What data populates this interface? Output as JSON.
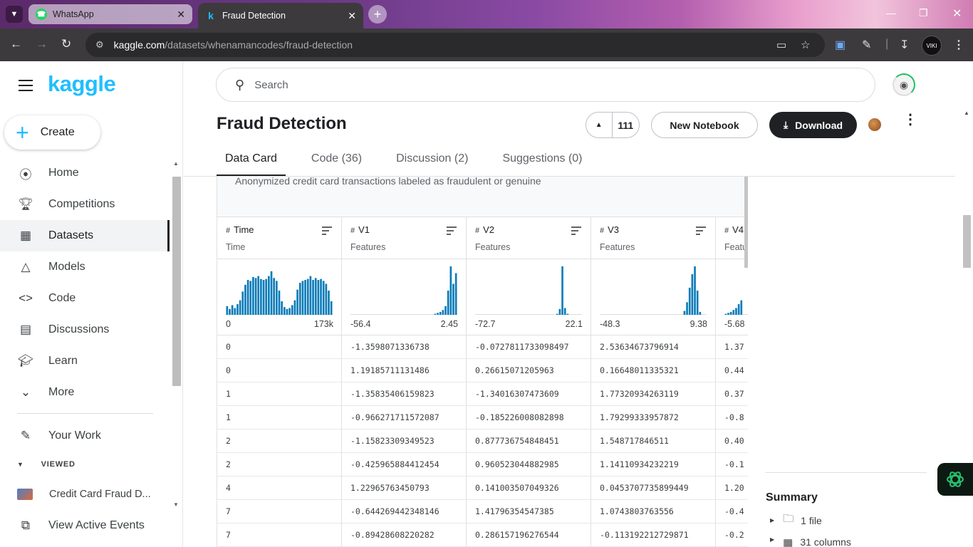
{
  "browser": {
    "tabs": [
      {
        "title": "WhatsApp"
      },
      {
        "title": "Fraud Detection"
      }
    ],
    "url_host": "kaggle.com",
    "url_path": "/datasets/whenamancodes/fraud-detection",
    "profile_label": "VIKI"
  },
  "sidebar": {
    "logo": "kaggle",
    "create_label": "Create",
    "items": [
      {
        "label": "Home",
        "icon": "compass-icon"
      },
      {
        "label": "Competitions",
        "icon": "trophy-icon"
      },
      {
        "label": "Datasets",
        "icon": "table-icon"
      },
      {
        "label": "Models",
        "icon": "models-icon"
      },
      {
        "label": "Code",
        "icon": "code-icon"
      },
      {
        "label": "Discussions",
        "icon": "discussion-icon"
      },
      {
        "label": "Learn",
        "icon": "school-icon"
      },
      {
        "label": "More",
        "icon": "chevron-down-icon"
      }
    ],
    "your_work": "Your Work",
    "viewed_label": "VIEWED",
    "viewed_item": "Credit Card Fraud D...",
    "view_events": "View Active Events"
  },
  "header": {
    "search_placeholder": "Search"
  },
  "dataset": {
    "title": "Fraud Detection",
    "upvotes": "111",
    "new_notebook": "New Notebook",
    "download": "Download",
    "tabs": [
      "Data Card",
      "Code (36)",
      "Discussion (2)",
      "Suggestions (0)"
    ],
    "subtitle": "Anonymized credit card transactions labeled as fraudulent or genuine"
  },
  "table": {
    "columns": [
      {
        "name": "Time",
        "type": "Time",
        "min": "0",
        "max": "173k",
        "hist": [
          0.18,
          0.12,
          0.2,
          0.14,
          0.22,
          0.3,
          0.48,
          0.62,
          0.72,
          0.7,
          0.78,
          0.76,
          0.8,
          0.74,
          0.72,
          0.74,
          0.8,
          0.9,
          0.76,
          0.7,
          0.5,
          0.28,
          0.16,
          0.12,
          0.14,
          0.2,
          0.3,
          0.52,
          0.66,
          0.7,
          0.72,
          0.74,
          0.8,
          0.72,
          0.76,
          0.72,
          0.74,
          0.7,
          0.64,
          0.5,
          0.28
        ]
      },
      {
        "name": "V1",
        "type": "Features",
        "min": "-56.4",
        "max": "2.45",
        "hist": [
          0,
          0,
          0,
          0,
          0,
          0,
          0,
          0,
          0,
          0,
          0,
          0,
          0,
          0,
          0,
          0,
          0,
          0,
          0,
          0,
          0,
          0,
          0,
          0,
          0,
          0,
          0,
          0,
          0,
          0,
          0,
          0,
          0.02,
          0.04,
          0.06,
          0.1,
          0.18,
          0.5,
          1.0,
          0.64,
          0.86
        ]
      },
      {
        "name": "V2",
        "type": "Features",
        "min": "-72.7",
        "max": "22.1",
        "hist": [
          0,
          0,
          0,
          0,
          0,
          0,
          0,
          0,
          0,
          0,
          0,
          0,
          0,
          0,
          0,
          0,
          0,
          0,
          0,
          0,
          0,
          0,
          0,
          0,
          0,
          0,
          0,
          0,
          0,
          0,
          0,
          0.02,
          0.12,
          1.0,
          0.14,
          0.02,
          0,
          0,
          0,
          0,
          0
        ]
      },
      {
        "name": "V3",
        "type": "Features",
        "min": "-48.3",
        "max": "9.38",
        "hist": [
          0,
          0,
          0,
          0,
          0,
          0,
          0,
          0,
          0,
          0,
          0,
          0,
          0,
          0,
          0,
          0,
          0,
          0,
          0,
          0,
          0,
          0,
          0,
          0,
          0,
          0,
          0,
          0,
          0,
          0,
          0,
          0,
          0.08,
          0.26,
          0.56,
          0.84,
          1.0,
          0.5,
          0.06,
          0,
          0
        ]
      },
      {
        "name": "V4",
        "type": "Features",
        "min": "-5.68",
        "max": "",
        "hist": [
          0.02,
          0.04,
          0.06,
          0.1,
          0.14,
          0.22,
          0.3
        ]
      }
    ],
    "rows": [
      [
        "0",
        "-1.3598071336738",
        "-0.0727811733098497",
        "2.53634673796914",
        "1.37"
      ],
      [
        "0",
        "1.19185711131486",
        "0.26615071205963",
        "0.16648011335321",
        "0.44"
      ],
      [
        "1",
        "-1.35835406159823",
        "-1.34016307473609",
        "1.77320934263119",
        "0.37"
      ],
      [
        "1",
        "-0.966271711572087",
        "-0.185226008082898",
        "1.79299333957872",
        "-0.8"
      ],
      [
        "2",
        "-1.15823309349523",
        "0.877736754848451",
        "1.548717846511",
        "0.40"
      ],
      [
        "2",
        "-0.425965884412454",
        "0.960523044882985",
        "1.14110934232219",
        "-0.1"
      ],
      [
        "4",
        "1.22965763450793",
        "0.141003507049326",
        "0.0453707735899449",
        "1.20"
      ],
      [
        "7",
        "-0.644269442348146",
        "1.41796354547385",
        "1.0743803763556",
        "-0.4"
      ],
      [
        "7",
        "-0.89428608220282",
        "0.286157196276544",
        "-0.113192212729871",
        "-0.2"
      ]
    ],
    "bar_color": "#0a7bb8"
  },
  "summary": {
    "title": "Summary",
    "files": "1 file",
    "columns": "31 columns"
  }
}
